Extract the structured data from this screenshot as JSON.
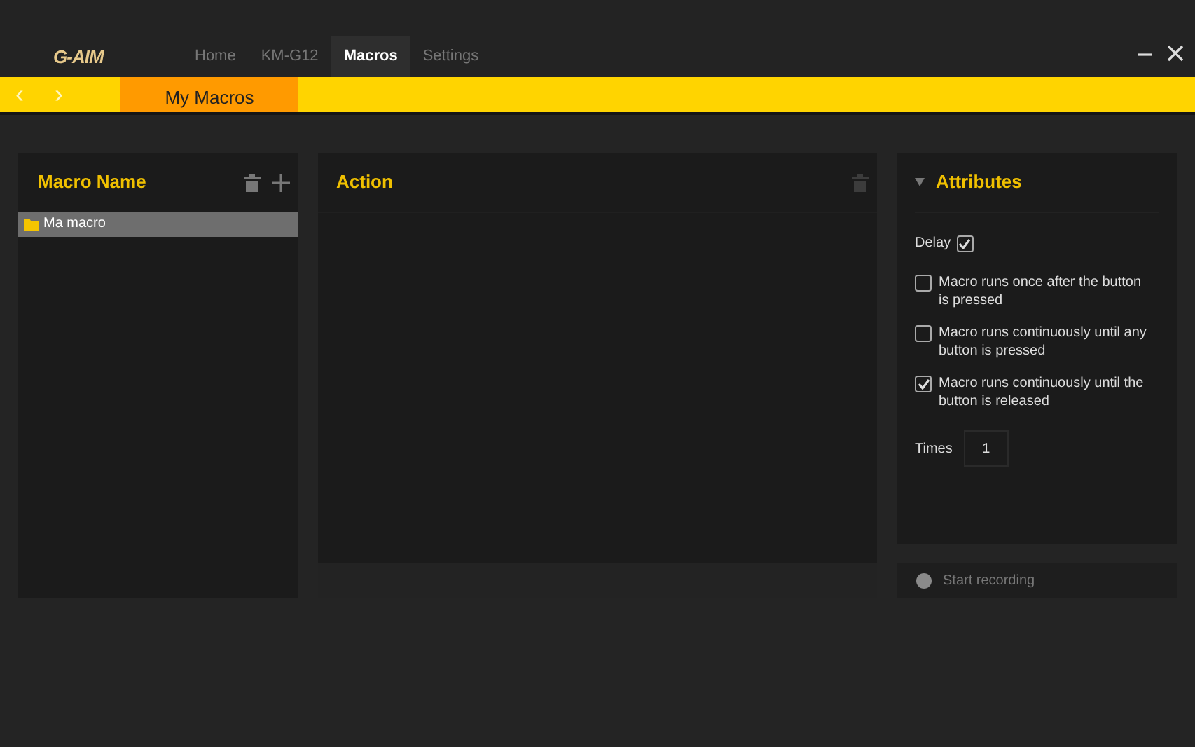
{
  "logo": "G-AIM",
  "tabs": [
    {
      "label": "Home",
      "selected": false
    },
    {
      "label": "KM-G12",
      "selected": false
    },
    {
      "label": "Macros",
      "selected": true
    },
    {
      "label": "Settings",
      "selected": false
    }
  ],
  "subbar": {
    "prev": "‹",
    "next": "›",
    "tabs": [
      {
        "label": "My Macros",
        "selected": true
      }
    ]
  },
  "macro_panel": {
    "title": "Macro Name",
    "items": [
      {
        "label": "Ma macro",
        "selected": true
      }
    ]
  },
  "action_panel": {
    "title": "Action"
  },
  "attributes": {
    "title": "Attributes",
    "expanded": true,
    "delay": {
      "label": "Delay",
      "checked": true
    },
    "options": [
      {
        "label": "Macro runs once after the button is pressed",
        "checked": false
      },
      {
        "label": "Macro runs continuously until any button is pressed",
        "checked": false
      },
      {
        "label": "Macro runs continuously until the button is released",
        "checked": true
      }
    ],
    "times": {
      "label": "Times",
      "value": "1"
    }
  },
  "recording": {
    "label": "Start recording"
  }
}
